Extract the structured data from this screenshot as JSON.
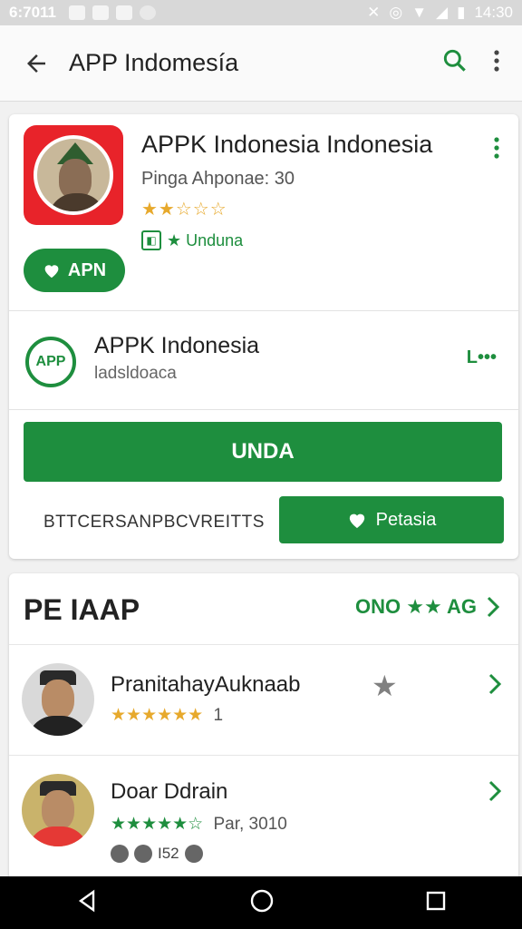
{
  "status_bar": {
    "time": "6:7011",
    "right_time": "14:30"
  },
  "app_bar": {
    "title": "APP Indomesía"
  },
  "app_header": {
    "title": "APPK Indonesia Indonesia",
    "subtitle": "Pinga Ahponae: 30",
    "rating_stars": "★★☆☆☆",
    "badge_text": "★ Unduna",
    "apk_button": "APN"
  },
  "app_entry": {
    "title": "APPK Indonesia",
    "subtitle": "ladsldoaca",
    "more_link": "L•••",
    "install_button": "UNDA",
    "small_text": "BTTCERSANPBCVREITTS",
    "secondary_button": "Petasia"
  },
  "section": {
    "title": "PE IAAP",
    "right_text": "ONO ★★ AG"
  },
  "reviews": [
    {
      "name": "PranitahayAuknaab",
      "stars": "★★★★★★",
      "meta": "1"
    },
    {
      "name": "Doar Ddrain",
      "stars": "★★★★★☆",
      "meta": "Par, 3010",
      "extra": "I52"
    }
  ],
  "colors": {
    "accent": "#1e8e3e",
    "app_icon_bg": "#e8232a",
    "star": "#e7a92c"
  }
}
